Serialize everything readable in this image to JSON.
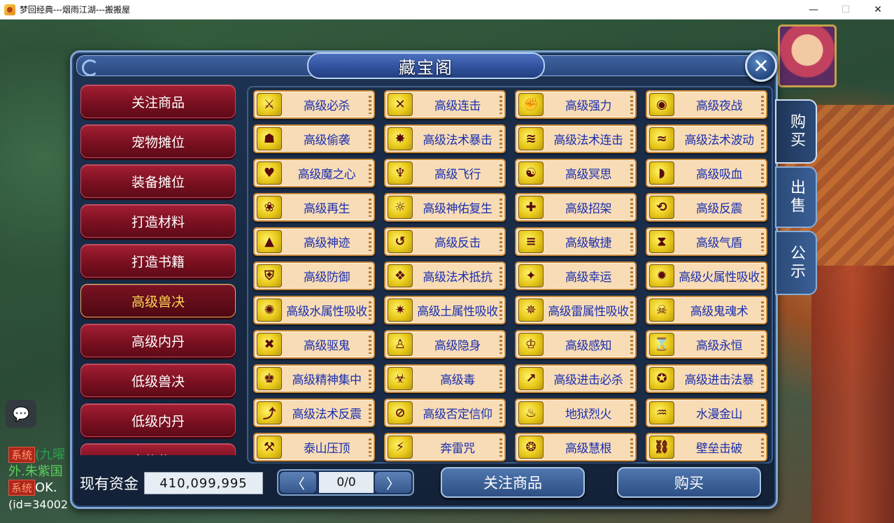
{
  "window": {
    "title": "梦回经典---烟雨江湖---搬搬屋",
    "minimize": "—",
    "maximize": "☐",
    "close": "✕"
  },
  "panel": {
    "title": "藏宝阁",
    "close_glyph": "✕"
  },
  "categories": [
    {
      "label": "关注商品",
      "active": false
    },
    {
      "label": "宠物摊位",
      "active": false
    },
    {
      "label": "装备摊位",
      "active": false
    },
    {
      "label": "打造材料",
      "active": false
    },
    {
      "label": "打造书籍",
      "active": false
    },
    {
      "label": "高级兽决",
      "active": true
    },
    {
      "label": "高级内丹",
      "active": false
    },
    {
      "label": "低级兽决",
      "active": false
    },
    {
      "label": "低级内丹",
      "active": false
    },
    {
      "label": "宠物物品",
      "active": false
    }
  ],
  "items": [
    [
      "高级必杀",
      "高级连击",
      "高级强力",
      "高级夜战"
    ],
    [
      "高级偷袭",
      "高级法术暴击",
      "高级法术连击",
      "高级法术波动"
    ],
    [
      "高级魔之心",
      "高级飞行",
      "高级冥思",
      "高级吸血"
    ],
    [
      "高级再生",
      "高级神佑复生",
      "高级招架",
      "高级反震"
    ],
    [
      "高级神迹",
      "高级反击",
      "高级敏捷",
      "高级气盾"
    ],
    [
      "高级防御",
      "高级法术抵抗",
      "高级幸运",
      "高级火属性吸收"
    ],
    [
      "高级水属性吸收",
      "高级土属性吸收",
      "高级雷属性吸收",
      "高级鬼魂术"
    ],
    [
      "高级驱鬼",
      "高级隐身",
      "高级感知",
      "高级永恒"
    ],
    [
      "高级精神集中",
      "高级毒",
      "高级进击必杀",
      "高级进击法暴"
    ],
    [
      "高级法术反震",
      "高级否定信仰",
      "地狱烈火",
      "水漫金山"
    ],
    [
      "泰山压顶",
      "奔雷咒",
      "高级慧根",
      "壁垒击破"
    ]
  ],
  "item_icons": [
    [
      "sword-icon",
      "crossed-blades-icon",
      "strength-icon",
      "eye-icon"
    ],
    [
      "sneak-icon",
      "fire-burst-icon",
      "multi-slash-icon",
      "wave-icon"
    ],
    [
      "heart-icon",
      "wing-icon",
      "meditate-icon",
      "fang-icon"
    ],
    [
      "regen-icon",
      "revive-icon",
      "parry-icon",
      "counter-shock-icon"
    ],
    [
      "miracle-icon",
      "counter-icon",
      "agility-icon",
      "shield-icon"
    ],
    [
      "defense-icon",
      "resist-icon",
      "luck-icon",
      "fire-absorb-icon"
    ],
    [
      "water-absorb-icon",
      "earth-absorb-icon",
      "thunder-absorb-icon",
      "ghost-icon"
    ],
    [
      "exorcise-icon",
      "stealth-icon",
      "perception-icon",
      "eternity-icon"
    ],
    [
      "focus-icon",
      "poison-icon",
      "assault-crit-icon",
      "assault-magic-icon"
    ],
    [
      "magic-reflect-icon",
      "deny-faith-icon",
      "hellfire-icon",
      "flood-icon"
    ],
    [
      "mountain-icon",
      "lightning-icon",
      "wisdom-icon",
      "barrier-break-icon"
    ]
  ],
  "item_glyphs": [
    [
      "⚔",
      "✕",
      "✊",
      "◉"
    ],
    [
      "☗",
      "✸",
      "≋",
      "≈"
    ],
    [
      "♥",
      "♆",
      "☯",
      "◗"
    ],
    [
      "❀",
      "☼",
      "✚",
      "⟲"
    ],
    [
      "▲",
      "↺",
      "≡",
      "⧗"
    ],
    [
      "⛨",
      "❖",
      "✦",
      "✹"
    ],
    [
      "✺",
      "✷",
      "✵",
      "☠"
    ],
    [
      "✖",
      "♙",
      "♔",
      "⌛"
    ],
    [
      "♚",
      "☣",
      "↗",
      "✪"
    ],
    [
      "⤴",
      "⊘",
      "♨",
      "♒"
    ],
    [
      "⚒",
      "⚡",
      "❂",
      "⛓"
    ]
  ],
  "side_tabs": [
    {
      "label": "购买",
      "active": true
    },
    {
      "label": "出售",
      "active": false
    },
    {
      "label": "公示",
      "active": false
    }
  ],
  "footer": {
    "funds_label": "现有资金",
    "funds_value": "410,099,995",
    "prev_glyph": "〈",
    "next_glyph": "〉",
    "page_text": "0/0",
    "watch_button": "关注商品",
    "buy_button": "购买"
  },
  "chat": {
    "icon": "💬",
    "sys_tag": "系统",
    "line1_tail": "(九曜",
    "line2": "外.朱紫国",
    "line3_tail": "OK.",
    "line4": "(id=34002"
  }
}
